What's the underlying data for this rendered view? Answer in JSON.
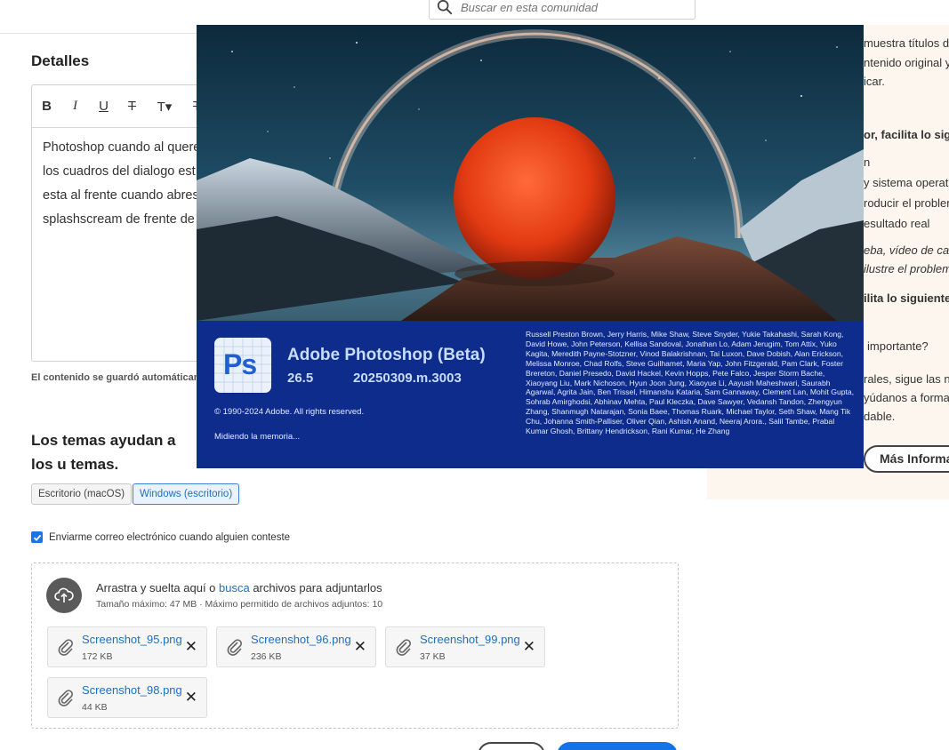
{
  "search": {
    "placeholder": "Buscar en esta comunidad"
  },
  "details": {
    "heading": "Detalles",
    "body_lines": [
      "Photoshop cuando al quere",
      "los cuadros del dialogo est",
      "esta al frente cuando abres",
      "splashscream de frente de"
    ],
    "autosave_text": "El contenido se guardó automáticame"
  },
  "topics": {
    "heading": "Los temas ayudan a los u temas.",
    "tags": [
      "Escritorio (macOS)",
      "Windows (escritorio)"
    ],
    "selected_tag": "Windows (escritorio)"
  },
  "notify": {
    "label": "Enviarme correo electrónico cuando alguien conteste",
    "checked": true
  },
  "upload": {
    "title_pre": "Arrastra y suelta aquí o ",
    "title_link": "busca",
    "title_post": " archivos para adjuntarlos",
    "subtitle": "Tamaño máximo: 47 MB · Máximo permitido de archivos adjuntos: 10",
    "files": [
      {
        "name": "Screenshot_95.png",
        "size": "172 KB"
      },
      {
        "name": "Screenshot_96.png",
        "size": "236 KB"
      },
      {
        "name": "Screenshot_99.png",
        "size": "37 KB"
      },
      {
        "name": "Screenshot_98.png",
        "size": "44 KB"
      }
    ]
  },
  "right_panel": {
    "lines": [
      "muestra títulos de",
      "ntenido original y",
      "icar.",
      "or, facilita lo sigui",
      "n",
      "y sistema operativ",
      "roducir el problem",
      "esultado real",
      "eba, vídeo de capt",
      "ilustre el problem",
      "ilita lo siguientes",
      "importante?",
      "rales, sigue las no",
      "yúdanos a forma",
      "dable."
    ],
    "more_button": "Más Informa"
  },
  "splash": {
    "logo_letters": "Ps",
    "app_name": "Adobe Photoshop (Beta)",
    "version": "26.5",
    "build": "20250309.m.3003",
    "copyright": "© 1990-2024 Adobe. All rights reserved.",
    "status": "Midiendo la memoria...",
    "credits": "Russell Preston Brown, Jerry Harris, Mike Shaw, Steve Snyder, Yukie Takahashi, Sarah Kong, David Howe, John Peterson, Kellisa Sandoval, Jonathan Lo, Adam Jerugim, Tom Attix, Yuko Kagita, Meredith Payne-Stotzner, Vinod Balakrishnan, Tai Luxon, Dave Dobish, Alan Erickson, Melissa Monroe, Chad Rolfs, Steve Guilhamet, Maria Yap, John Fitzgerald, Pam Clark, Foster Brereton, Daniel Presedo, David Hackel, Kevin Hopps, Pete Falco, Jesper Storm Bache, Xiaoyang Liu, Mark Nichoson, Hyun Joon Jung, Xiaoyue Li, Aayush Maheshwari, Saurabh Agarwal, Agrita Jain, Ben Trissel, Himanshu Kataria, Sam Gannaway, Clement Lan, Mohit Gupta, Sohrab Amirghodsi, Abhinav Mehta, Paul Kleczka, Dave Sawyer, Vedansh Tandon, Zhengyun Zhang, Shanmugh Natarajan, Sonia Baee, Thomas Ruark, Michael Taylor, Seth Shaw, Mang Tik Chu, Johanna Smith-Palliser, Oliver Qian, Ashish Anand, Neeraj Arora., Salil Tambe, Prabal Kumar Ghosh, Brittany Hendrickson, Rani Kumar, He Zhang"
  }
}
